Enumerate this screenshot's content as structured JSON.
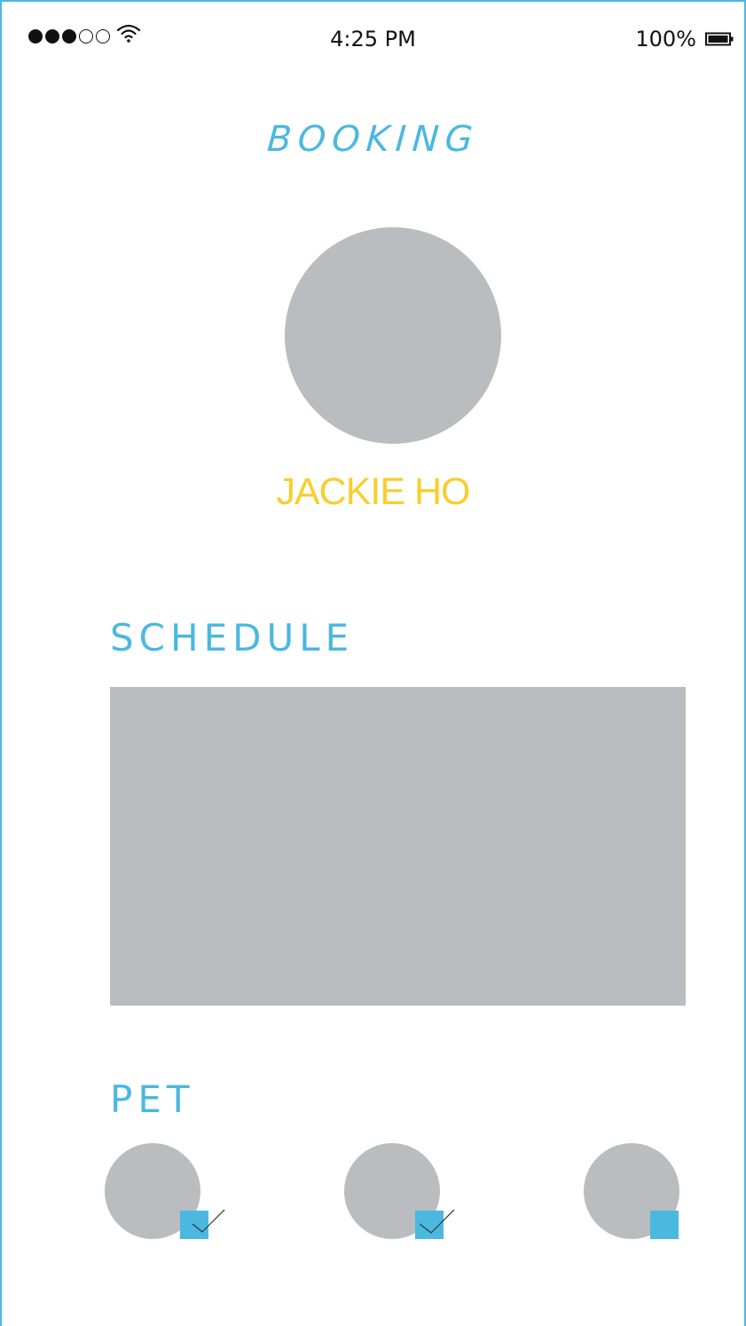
{
  "status_bar": {
    "time": "4:25 PM",
    "battery_percent": "100%",
    "signal_filled": 3,
    "signal_total": 5
  },
  "header": {
    "title": "BOOKING"
  },
  "profile": {
    "name": "JACKIE HO"
  },
  "schedule": {
    "heading": "SCHEDULE"
  },
  "pets": {
    "heading": "PET",
    "items": [
      {
        "checked": true
      },
      {
        "checked": true
      },
      {
        "checked": false
      }
    ]
  },
  "colors": {
    "accent": "#4bb8e0",
    "name": "#f8ce2e",
    "placeholder": "#bbbcbf"
  }
}
